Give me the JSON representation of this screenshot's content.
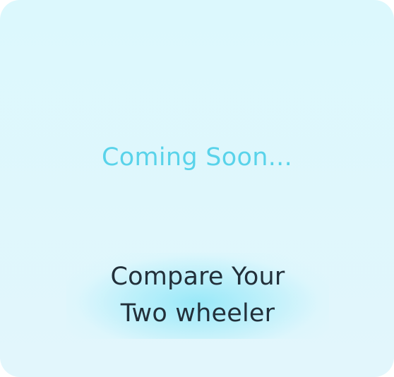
{
  "card": {
    "status_text": "Coming Soon...",
    "title_line_1": "Compare Your",
    "title_line_2": "Two wheeler"
  },
  "colors": {
    "status": "#59d3ea",
    "title": "#22303a",
    "background": "#dcf8fd",
    "highlight": "#96e8f8"
  }
}
